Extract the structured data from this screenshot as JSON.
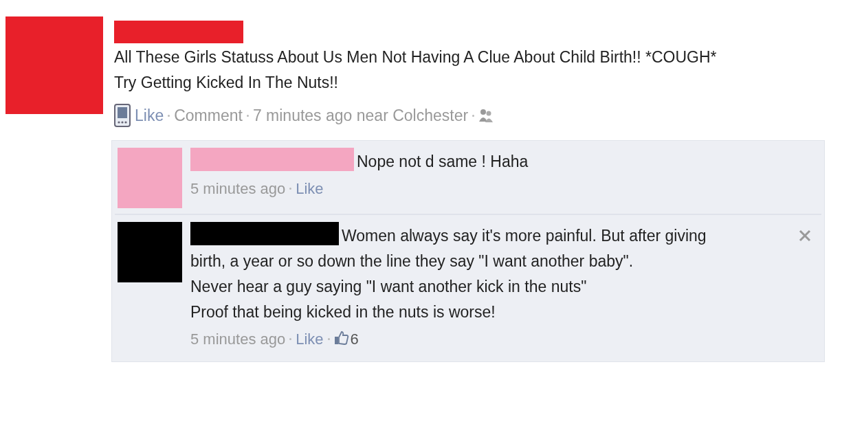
{
  "post": {
    "avatar": {
      "color": "#e8202a"
    },
    "name_bar": {
      "color": "#e8202a"
    },
    "text": "All These Girls Statuss About Us Men Not Having A Clue About Child Birth!! *COUGH*\nTry Getting Kicked In The Nuts!!",
    "actions": [
      "Like",
      "Comment"
    ],
    "time": "7 minutes ago near Colchester"
  },
  "comments": [
    {
      "avatar": {
        "color": "#f4a6c1"
      },
      "name_bar": {
        "color": "#f4a6c1"
      },
      "text": "Nope not d same ! Haha",
      "time": "5 minutes ago",
      "like": "Like",
      "removable": false
    },
    {
      "avatar": {
        "color": "#000000"
      },
      "name_bar": {
        "color": "#000000"
      },
      "text": "Women always say it's more painful. But after giving\nbirth, a year or so down the line they say \"I want another baby\".\nNever hear a guy saying \"I want another kick in the nuts\"\nProof that being kicked in the nuts is worse!",
      "time": "5 minutes ago",
      "like": "Like",
      "likes": "6",
      "removable": true
    }
  ]
}
